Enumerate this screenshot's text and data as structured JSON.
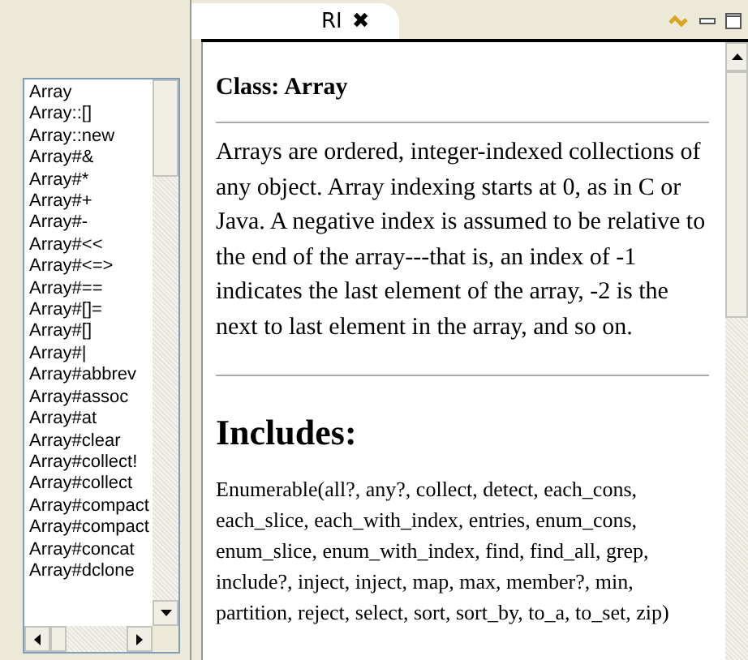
{
  "index_list": {
    "items": [
      "Array",
      "Array::[]",
      "Array::new",
      "Array#&",
      "Array#*",
      "Array#+",
      "Array#-",
      "Array#<<",
      "Array#<=>",
      "Array#==",
      "Array#[]=",
      "Array#[]",
      "Array#|",
      "Array#abbrev",
      "Array#assoc",
      "Array#at",
      "Array#clear",
      "Array#collect!",
      "Array#collect",
      "Array#compact",
      "Array#compact",
      "Array#concat",
      "Array#dclone"
    ]
  },
  "view": {
    "tab": {
      "title": "RI",
      "close": "✖"
    },
    "heading": "Class: Array",
    "description": "Arrays are ordered, integer-indexed collections of any object. Array indexing starts at 0, as in C or Java. A negative index is assumed to be relative to the end of the array---that is, an index of -1 indicates the last element of the array, -2 is the next to last element in the array, and so on.",
    "includes_heading": "Includes:",
    "includes_text": "Enumerable(all?, any?, collect, detect, each_cons, each_slice, each_with_index, entries, enum_cons, enum_slice, enum_with_index, find, find_all, grep, include?, inject, inject, map, max, member?, min, partition, reject, select, sort, sort_by, to_a, to_set, zip)"
  }
}
